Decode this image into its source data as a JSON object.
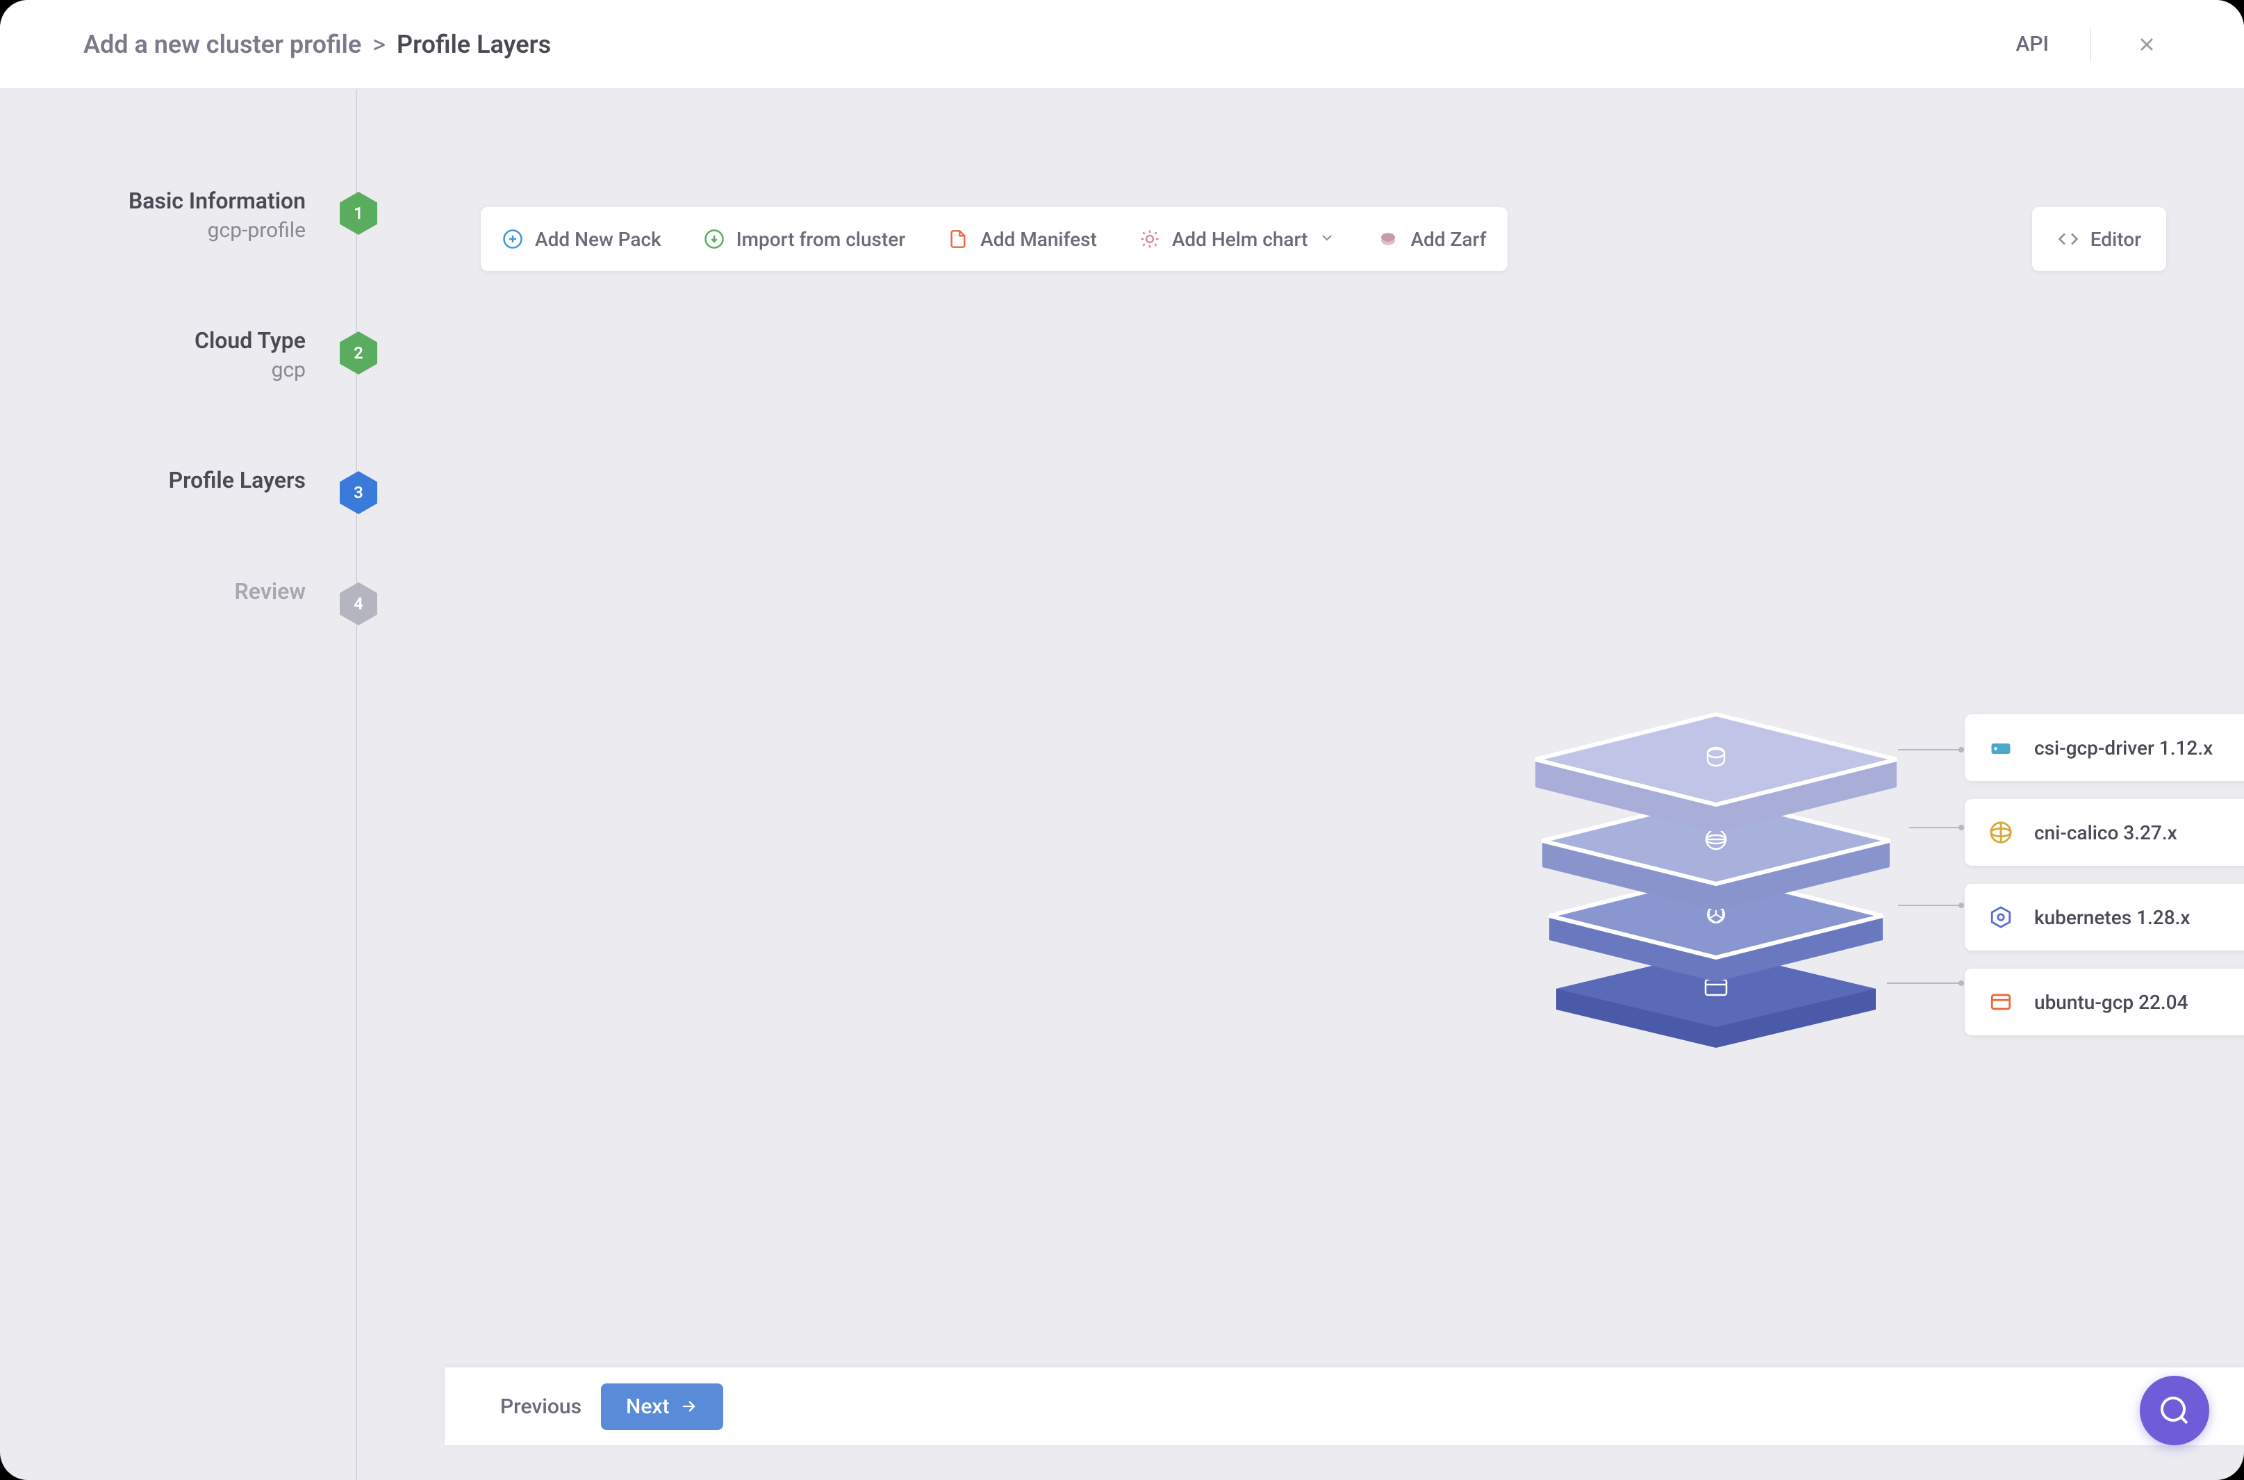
{
  "header": {
    "breadcrumb_parent": "Add a new cluster profile",
    "breadcrumb_current": "Profile Layers",
    "api_label": "API"
  },
  "steps": [
    {
      "num": "1",
      "title": "Basic Information",
      "sub": "gcp-profile",
      "state": "done"
    },
    {
      "num": "2",
      "title": "Cloud Type",
      "sub": "gcp",
      "state": "done"
    },
    {
      "num": "3",
      "title": "Profile Layers",
      "sub": "",
      "state": "active"
    },
    {
      "num": "4",
      "title": "Review",
      "sub": "",
      "state": "pending"
    }
  ],
  "toolbar": {
    "add_pack": "Add New Pack",
    "import_cluster": "Import from cluster",
    "add_manifest": "Add Manifest",
    "add_helm": "Add Helm chart",
    "add_zarf": "Add Zarf",
    "editor": "Editor"
  },
  "layers": [
    {
      "name": "csi-gcp-driver 1.12.x",
      "type": "Storage",
      "type_class": "storage",
      "icon_color": "#4aa8c8"
    },
    {
      "name": "cni-calico 3.27.x",
      "type": "Network",
      "type_class": "network",
      "icon_color": "#d8a83a"
    },
    {
      "name": "kubernetes 1.28.x",
      "type": "Kubernetes",
      "type_class": "kubernetes",
      "icon_color": "#5a6ed8"
    },
    {
      "name": "ubuntu-gcp 22.04",
      "type": "OS",
      "type_class": "os",
      "icon_color": "#e8683a"
    }
  ],
  "footer": {
    "prev": "Previous",
    "next": "Next"
  }
}
